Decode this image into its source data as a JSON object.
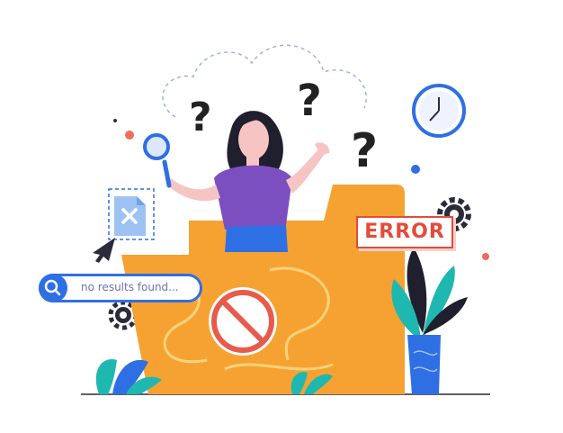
{
  "search": {
    "text": "no results found..."
  },
  "error_badge": {
    "text": "ERROR"
  },
  "icons": [
    "question-mark-icon",
    "magnifier-icon",
    "clock-icon",
    "gear-icon",
    "file-x-icon",
    "cursor-arrow-icon",
    "no-entry-icon",
    "plant-icon"
  ],
  "colors": {
    "folder": "#f6a233",
    "folder_dark": "#e8872a",
    "blue": "#2f6fe4",
    "red": "#e44b3a",
    "purple": "#7c4fc1",
    "teal": "#1fb8b0"
  }
}
